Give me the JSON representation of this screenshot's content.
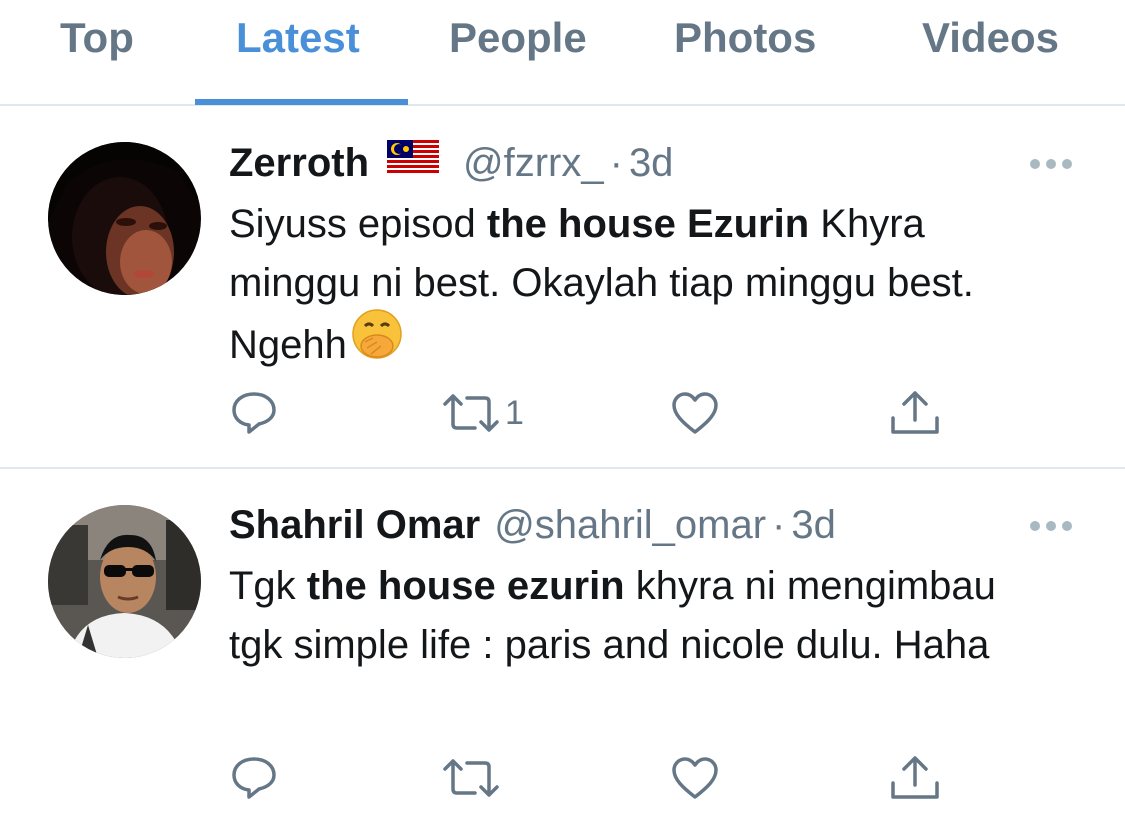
{
  "tabs": [
    {
      "label": "Top"
    },
    {
      "label": "Latest"
    },
    {
      "label": "People"
    },
    {
      "label": "Photos"
    },
    {
      "label": "Videos"
    }
  ],
  "active_tab": "Latest",
  "accent_color": "#4a90d9",
  "tweets": [
    {
      "display_name": "Zerroth",
      "flag": "malaysia-flag",
      "handle": "@fzrrx_",
      "separator": "·",
      "time": "3d",
      "text_1": "Siyuss episod ",
      "text_bold": "the house Ezurin",
      "text_2": " Khyra minggu ni best. Okaylah tiap minggu best. Ngehh",
      "emoji": "face-with-hand-over-mouth",
      "retweet_count": "1"
    },
    {
      "display_name": "Shahril Omar",
      "handle": "@shahril_omar",
      "separator": "·",
      "time": "3d",
      "text_1": "Tgk ",
      "text_bold": "the house ezurin",
      "text_2": " khyra ni mengimbau tgk simple life : paris and nicole dulu. Haha",
      "retweet_count": ""
    }
  ]
}
